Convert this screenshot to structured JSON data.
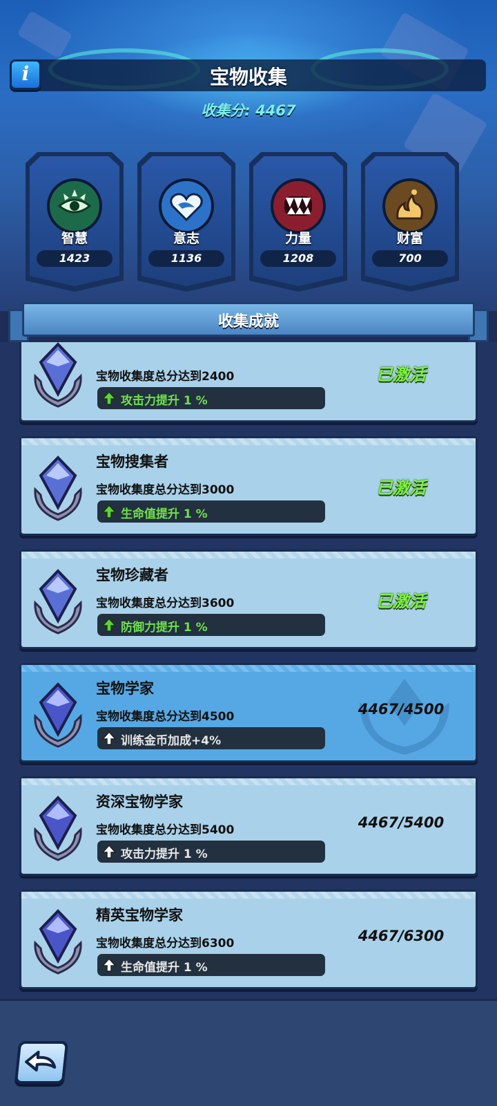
{
  "header": {
    "info_label": "i",
    "title": "宝物收集",
    "score": "收集分: 4467"
  },
  "stats": [
    {
      "name": "智慧",
      "value": "1423",
      "icon": "eye-emblem-icon",
      "color": "#1d6a4a"
    },
    {
      "name": "意志",
      "value": "1136",
      "icon": "heart-shark-icon",
      "color": "#2c72c8"
    },
    {
      "name": "力量",
      "value": "1208",
      "icon": "fangs-icon",
      "color": "#8a1e2e"
    },
    {
      "name": "财富",
      "value": "700",
      "icon": "gold-flame-icon",
      "color": "#6b4a22"
    }
  ],
  "achievements_title": "收集成就",
  "achievements": [
    {
      "name": "",
      "requirement": "宝物收集度总分达到2400",
      "bonus": "攻击力提升 1 %",
      "status": "已激活",
      "state": "active"
    },
    {
      "name": "宝物搜集者",
      "requirement": "宝物收集度总分达到3000",
      "bonus": "生命值提升 1 %",
      "status": "已激活",
      "state": "active"
    },
    {
      "name": "宝物珍藏者",
      "requirement": "宝物收集度总分达到3600",
      "bonus": "防御力提升 1 %",
      "status": "已激活",
      "state": "active"
    },
    {
      "name": "宝物学家",
      "requirement": "宝物收集度总分达到4500",
      "bonus": "训练金币加成+4%",
      "status": "4467/4500",
      "state": "current"
    },
    {
      "name": "资深宝物学家",
      "requirement": "宝物收集度总分达到5400",
      "bonus": "攻击力提升 1 %",
      "status": "4467/5400",
      "state": "locked"
    },
    {
      "name": "精英宝物学家",
      "requirement": "宝物收集度总分达到6300",
      "bonus": "生命值提升 1 %",
      "status": "4467/6300",
      "state": "locked"
    }
  ],
  "colors": {
    "active_green": "#7cf43c",
    "highlight_row": "#56a8e4",
    "row_bg": "#a9d1ea"
  },
  "footer": {
    "back_icon": "back-arrow-icon"
  }
}
